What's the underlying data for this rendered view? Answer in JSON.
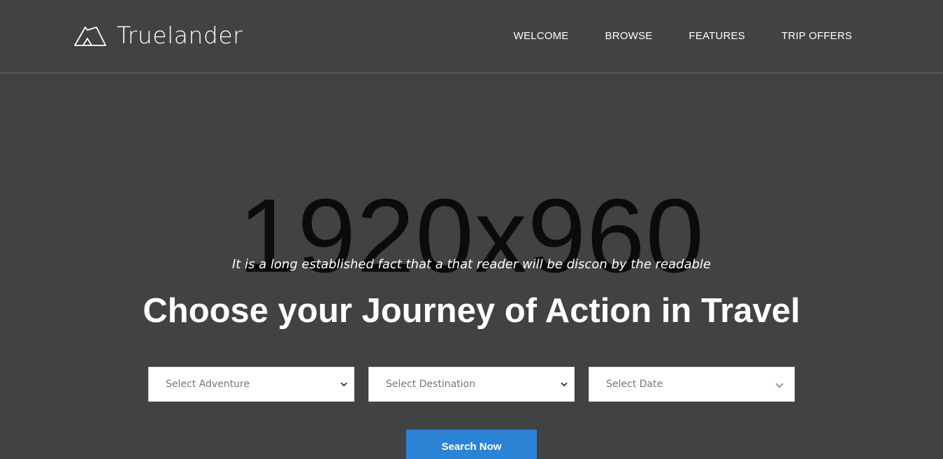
{
  "brand": {
    "name": "Truelander",
    "icon": "tent-icon"
  },
  "nav": {
    "items": [
      {
        "label": "WELCOME"
      },
      {
        "label": "BROWSE"
      },
      {
        "label": "FEATURES"
      },
      {
        "label": "TRIP OFFERS"
      }
    ]
  },
  "hero": {
    "placeholder": "1920x960",
    "tagline": "It is a long established fact that a that reader will be discon by the readable",
    "headline": "Choose your Journey of Action in Travel"
  },
  "search": {
    "adventure": "Select Adventure",
    "destination": "Select Destination",
    "date": "Select Date",
    "button": "Search Now"
  },
  "colors": {
    "background": "#424242",
    "button": "#2b83d6",
    "text": "#ffffff"
  }
}
